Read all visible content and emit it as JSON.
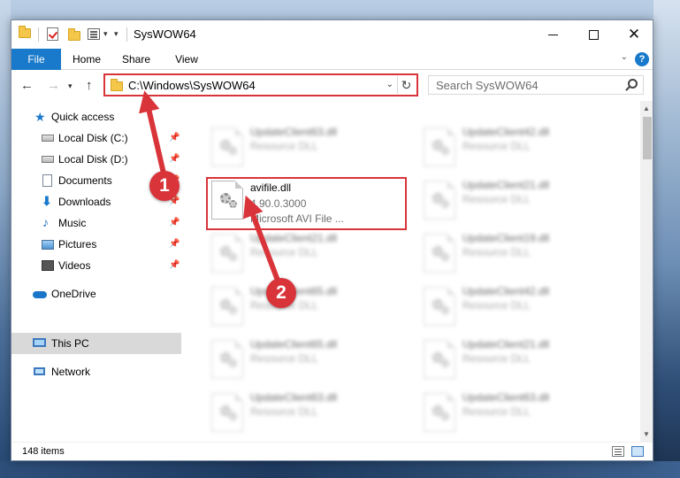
{
  "window": {
    "title": "SysWOW64",
    "qa_dropdown": "▾"
  },
  "ribbon": {
    "tabs": [
      "File",
      "Home",
      "Share",
      "View"
    ],
    "help": "?"
  },
  "address": {
    "path": "C:\\Windows\\SysWOW64",
    "search_placeholder": "Search SysWOW64"
  },
  "nav": {
    "items": [
      {
        "label": "Quick access",
        "icon": "star-icon"
      },
      {
        "label": "Local Disk (C:)",
        "icon": "disk-icon",
        "pinned": true
      },
      {
        "label": "Local Disk (D:)",
        "icon": "disk-icon",
        "pinned": true
      },
      {
        "label": "Documents",
        "icon": "document-icon",
        "pinned": true
      },
      {
        "label": "Downloads",
        "icon": "download-icon",
        "pinned": true
      },
      {
        "label": "Music",
        "icon": "music-icon",
        "pinned": true
      },
      {
        "label": "Pictures",
        "icon": "picture-icon",
        "pinned": true
      },
      {
        "label": "Videos",
        "icon": "video-icon",
        "pinned": true
      },
      {
        "label": "OneDrive",
        "icon": "cloud-icon"
      },
      {
        "label": "This PC",
        "icon": "computer-icon",
        "selected": true
      },
      {
        "label": "Network",
        "icon": "network-icon"
      }
    ]
  },
  "files": {
    "highlighted": {
      "name": "avifile.dll",
      "version": "4.90.0.3000",
      "description": "Microsoft AVI File ..."
    },
    "blurred_left": [
      {
        "name": "UpdateClient63.dll",
        "type": "Resource DLL"
      },
      {
        "name": "UpdateClient21.dll",
        "type": "Resource DLL"
      },
      {
        "name": "UpdateClient65.dll",
        "type": "Resource DLL"
      },
      {
        "name": "UpdateClient65.dll",
        "type": "Resource DLL"
      },
      {
        "name": "UpdateClient63.dll",
        "type": "Resource DLL"
      }
    ],
    "blurred_right": [
      {
        "name": "UpdateClient42.dll",
        "type": "Resource DLL"
      },
      {
        "name": "UpdateClient21.dll",
        "type": "Resource DLL"
      },
      {
        "name": "UpdateClient19.dll",
        "type": "Resource DLL"
      },
      {
        "name": "UpdateClient42.dll",
        "type": "Resource DLL"
      },
      {
        "name": "UpdateClient21.dll",
        "type": "Resource DLL"
      },
      {
        "name": "UpdateClient63.dll",
        "type": "Resource DLL"
      }
    ]
  },
  "status": {
    "item_count": "148 items"
  },
  "callouts": {
    "step1": "1",
    "step2": "2"
  },
  "colors": {
    "accent": "#1979ca",
    "callout": "#d9343a"
  }
}
